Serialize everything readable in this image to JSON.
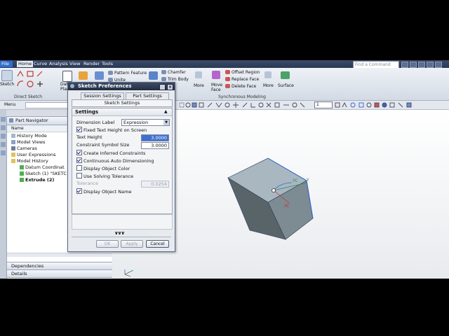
{
  "menubar": {
    "file": "File",
    "tabs": [
      "Home",
      "Curve",
      "Analysis",
      "View",
      "Render",
      "Tools"
    ],
    "find_placeholder": "Find a Command"
  },
  "ribbon": {
    "sketch_label": "Sketch",
    "direct_sketch_group": "Direct Sketch",
    "datum_label": "Datum",
    "datum_sub": "Plane",
    "pattern_feature": "Pattern Feature",
    "unite": "Unite",
    "chamfer": "Chamfer",
    "trim_body": "Trim Body",
    "more1": "More",
    "move_face": "Move",
    "move_face2": "Face",
    "offset_region": "Offset Region",
    "replace_face": "Replace Face",
    "delete_face": "Delete Face",
    "more2": "More",
    "surface": "Surface",
    "synchronous_group": "Synchronous Modeling"
  },
  "toolbar": {
    "menu_label": "Menu",
    "layer_value": "1"
  },
  "navigator": {
    "title": "Part Navigator",
    "column": "Name",
    "items": [
      {
        "label": "History Mode"
      },
      {
        "label": "Model Views"
      },
      {
        "label": "Cameras"
      },
      {
        "label": "User Expressions"
      },
      {
        "label": "Model History"
      },
      {
        "label": "Datum Coordinat"
      },
      {
        "label": "Sketch (1) \"SKETC"
      },
      {
        "label": "Extrude (2)"
      }
    ],
    "dependencies": "Dependencies",
    "details": "Details"
  },
  "dialog": {
    "title": "Sketch Preferences",
    "tabs": [
      "Session Settings",
      "Part Settings"
    ],
    "section_header": "Sketch Settings",
    "group_title": "Settings",
    "dimension_label": "Dimension Label",
    "dimension_value": "Expression",
    "fixed_text_height": "Fixed Text Height on Screen",
    "text_height_label": "Text Height",
    "text_height_value": "3.0000",
    "constraint_symbol_label": "Constraint Symbol Size",
    "constraint_symbol_value": "3.0000",
    "create_inferred": "Create Inferred Constraints",
    "continuous_auto": "Continuous Auto Dimensioning",
    "display_object_color": "Display Object Color",
    "use_solving_tolerance": "Use Solving Tolerance",
    "tolerance_label": "Tolerance",
    "tolerance_value": "0.0254",
    "display_object_name": "Display Object Name",
    "more_chevrons": "∨∨∨",
    "ok": "OK",
    "apply": "Apply",
    "cancel": "Cancel",
    "checks": {
      "fixed_text_height": true,
      "create_inferred": true,
      "continuous_auto": true,
      "display_object_color": false,
      "use_solving_tolerance": false,
      "display_object_name": true
    }
  },
  "viewport": {
    "axis_yc": "YC",
    "axis_xc": "XC",
    "axis_y": "Y"
  }
}
